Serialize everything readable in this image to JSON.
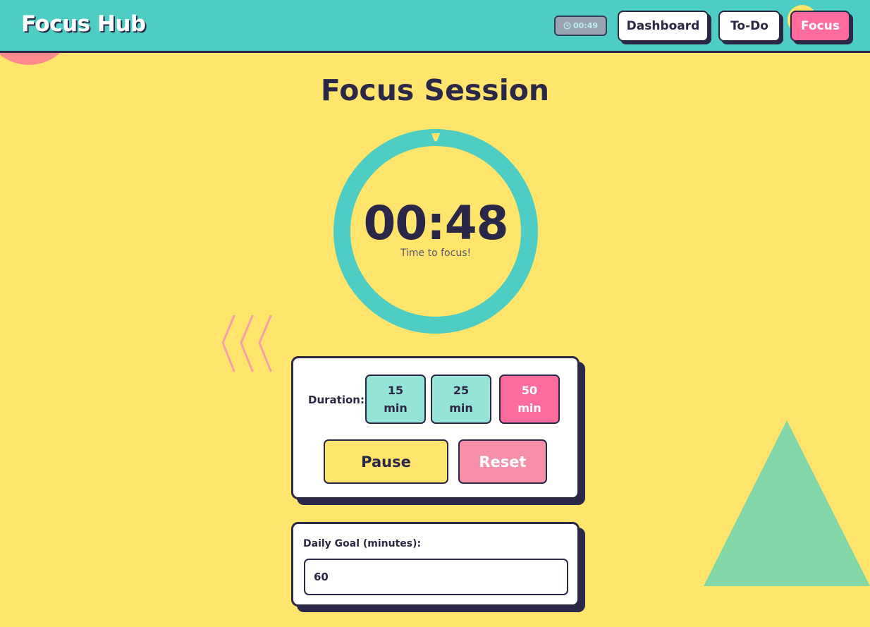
{
  "header": {
    "logo": "Focus Hub",
    "timer_badge": "00:49",
    "nav": {
      "dashboard": "Dashboard",
      "todo": "To-Do",
      "focus": "Focus"
    }
  },
  "main": {
    "title": "Focus Session",
    "timer": {
      "time": "00:48",
      "subtitle": "Time to focus!"
    },
    "controls": {
      "duration_label": "Duration:",
      "durations": [
        {
          "value": "15",
          "unit": "min",
          "active": false
        },
        {
          "value": "25",
          "unit": "min",
          "active": false
        },
        {
          "value": "50",
          "unit": "min",
          "active": true
        }
      ],
      "pause_label": "Pause",
      "reset_label": "Reset"
    },
    "goal": {
      "label": "Daily Goal (minutes):",
      "value": "60"
    }
  },
  "colors": {
    "background": "#FFE56C",
    "header": "#4ECDC4",
    "accent_pink": "#FF6B9D",
    "dark": "#2B2748",
    "teal_light": "#96E3D7",
    "triangle": "#82D6A8"
  }
}
